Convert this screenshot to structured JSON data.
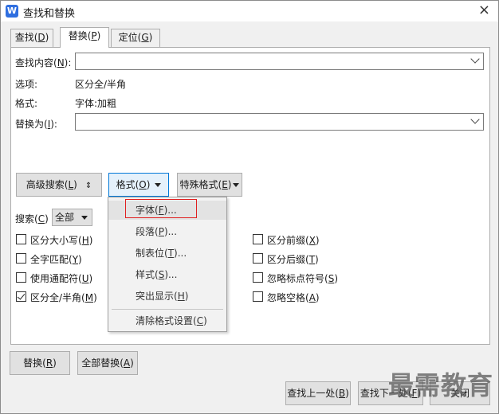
{
  "window": {
    "title": "查找和替换",
    "close": "×"
  },
  "tabs": [
    {
      "pre": "查找(",
      "key": "D",
      "post": ")"
    },
    {
      "pre": "替换(",
      "key": "P",
      "post": ")"
    },
    {
      "pre": "定位(",
      "key": "G",
      "post": ")"
    }
  ],
  "find": {
    "label_pre": "查找内容(",
    "label_key": "N",
    "label_post": "):",
    "value": ""
  },
  "options": {
    "label": "选项:",
    "value": "区分全/半角"
  },
  "format": {
    "label": "格式:",
    "value": "字体:加粗"
  },
  "replace": {
    "label_pre": "替换为(",
    "label_key": "I",
    "label_post": "):",
    "value": ""
  },
  "buttons": {
    "advanced": {
      "pre": "高级搜索(",
      "key": "L",
      "post": ")",
      "arrow": "⇕"
    },
    "format": {
      "pre": "格式(",
      "key": "O",
      "post": ")"
    },
    "special": {
      "pre": "特殊格式(",
      "key": "E",
      "post": ")"
    },
    "replace": {
      "pre": "替换(",
      "key": "R",
      "post": ")"
    },
    "replace_all": {
      "pre": "全部替换(",
      "key": "A",
      "post": ")"
    },
    "find_prev": {
      "pre": "查找上一处(",
      "key": "B",
      "post": ")"
    },
    "find_next": {
      "pre": "查找下一处(",
      "key": "F",
      "post": ")"
    },
    "close": "关闭"
  },
  "search": {
    "label_pre": "搜索(",
    "label_key": "C",
    "label_post": ")",
    "selected": "全部"
  },
  "checkboxes_left": [
    {
      "pre": "区分大小写(",
      "key": "H",
      "post": ")",
      "checked": false
    },
    {
      "pre": "全字匹配(",
      "key": "Y",
      "post": ")",
      "checked": false
    },
    {
      "pre": "使用通配符(",
      "key": "U",
      "post": ")",
      "checked": false
    },
    {
      "pre": "区分全/半角(",
      "key": "M",
      "post": ")",
      "checked": true
    }
  ],
  "checkboxes_right": [
    {
      "pre": "区分前缀(",
      "key": "X",
      "post": ")",
      "checked": false
    },
    {
      "pre": "区分后缀(",
      "key": "T",
      "post": ")",
      "checked": false
    },
    {
      "pre": "忽略标点符号(",
      "key": "S",
      "post": ")",
      "checked": false
    },
    {
      "pre": "忽略空格(",
      "key": "A",
      "post": ")",
      "checked": false
    }
  ],
  "format_menu": [
    {
      "pre": "字体(",
      "key": "F",
      "post": ")..."
    },
    {
      "pre": "段落(",
      "key": "P",
      "post": ")..."
    },
    {
      "pre": "制表位(",
      "key": "T",
      "post": ")..."
    },
    {
      "pre": "样式(",
      "key": "S",
      "post": ")..."
    },
    {
      "pre": "突出显示(",
      "key": "H",
      "post": ")"
    },
    {
      "pre": "清除格式设置(",
      "key": "C",
      "post": ")"
    }
  ],
  "watermark": "最需教育"
}
